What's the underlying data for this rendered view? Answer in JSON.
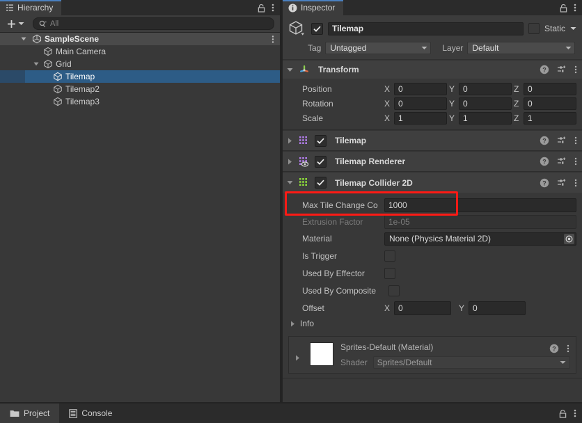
{
  "hierarchy": {
    "tab_label": "Hierarchy",
    "tab_icon": "hierarchy-icon",
    "lock_icon": "lock-icon",
    "menu_icon": "kebab-menu-icon",
    "create_button_label": "+",
    "search": {
      "placeholder": "All",
      "value": "",
      "icon": "search-icon"
    },
    "items": [
      {
        "label": "SampleScene",
        "depth": 0,
        "icon": "unity-scene-icon",
        "expanded": true,
        "selected": false,
        "is_scene": true,
        "has_menu": true
      },
      {
        "label": "Main Camera",
        "depth": 2,
        "icon": "gameobject-cube-icon",
        "expanded": null,
        "selected": false,
        "is_scene": false,
        "has_menu": false
      },
      {
        "label": "Grid",
        "depth": 1,
        "icon": "gameobject-cube-icon",
        "expanded": true,
        "selected": false,
        "is_scene": false,
        "has_menu": false
      },
      {
        "label": "Tilemap",
        "depth": 2,
        "icon": "gameobject-cube-icon",
        "expanded": null,
        "selected": true,
        "is_scene": false,
        "has_menu": false
      },
      {
        "label": "Tilemap2",
        "depth": 2,
        "icon": "gameobject-cube-icon",
        "expanded": null,
        "selected": false,
        "is_scene": false,
        "has_menu": false
      },
      {
        "label": "Tilemap3",
        "depth": 2,
        "icon": "gameobject-cube-icon",
        "expanded": null,
        "selected": false,
        "is_scene": false,
        "has_menu": false
      }
    ]
  },
  "inspector": {
    "tab_label": "Inspector",
    "tab_icon": "info-icon",
    "lock_icon": "lock-icon",
    "menu_icon": "kebab-menu-icon",
    "gameobject": {
      "icon": "gameobject-cube-icon",
      "enabled": true,
      "name": "Tilemap",
      "static_label": "Static",
      "static_checked": false,
      "tag_label": "Tag",
      "tag_value": "Untagged",
      "layer_label": "Layer",
      "layer_value": "Default"
    },
    "components": [
      {
        "name": "Transform",
        "icon": "transform-axis-icon",
        "expanded": true,
        "has_enable_checkbox": false,
        "enabled": true,
        "highlighted": false,
        "rows": [
          {
            "kind": "vector3",
            "label": "Position",
            "x": "0",
            "y": "0",
            "z": "0"
          },
          {
            "kind": "vector3",
            "label": "Rotation",
            "x": "0",
            "y": "0",
            "z": "0"
          },
          {
            "kind": "vector3",
            "label": "Scale",
            "x": "1",
            "y": "1",
            "z": "1"
          }
        ]
      },
      {
        "name": "Tilemap",
        "icon": "tilemap-purple-icon",
        "expanded": false,
        "has_enable_checkbox": true,
        "enabled": true,
        "highlighted": false,
        "rows": []
      },
      {
        "name": "Tilemap Renderer",
        "icon": "tilemap-renderer-purple-icon",
        "expanded": false,
        "has_enable_checkbox": true,
        "enabled": true,
        "highlighted": false,
        "rows": []
      },
      {
        "name": "Tilemap Collider 2D",
        "icon": "tilemap-collider-green-icon",
        "expanded": true,
        "has_enable_checkbox": true,
        "enabled": true,
        "highlighted": true,
        "rows": [
          {
            "kind": "text",
            "label": "Max Tile Change Co",
            "value": "1000",
            "disabled": false
          },
          {
            "kind": "text",
            "label": "Extrusion Factor",
            "value": "1e-05",
            "disabled": true
          },
          {
            "kind": "object",
            "label": "Material",
            "value": "None (Physics Material 2D)",
            "picker_icon": "object-picker-icon"
          },
          {
            "kind": "checkbox",
            "label": "Is Trigger",
            "checked": false
          },
          {
            "kind": "checkbox",
            "label": "Used By Effector",
            "checked": false
          },
          {
            "kind": "checkbox",
            "label": "Used By Composite",
            "checked": false
          },
          {
            "kind": "vector2",
            "label": "Offset",
            "x": "0",
            "y": "0"
          },
          {
            "kind": "foldout",
            "label": "Info",
            "expanded": false
          }
        ]
      }
    ],
    "header_icons": {
      "help": "help-icon",
      "preset": "preset-icon",
      "menu": "kebab-menu-icon"
    },
    "material_preview": {
      "title": "Sprites-Default (Material)",
      "shader_label": "Shader",
      "shader_value": "Sprites/Default",
      "swatch_color": "#ffffff",
      "help_icon": "help-icon",
      "menu_icon": "kebab-menu-icon",
      "expanded": false
    }
  },
  "bottom_bar": {
    "tabs": [
      {
        "label": "Project",
        "icon": "folder-icon",
        "active": true
      },
      {
        "label": "Console",
        "icon": "console-icon",
        "active": false
      }
    ],
    "lock_icon": "lock-icon",
    "menu_icon": "kebab-menu-icon"
  },
  "annotation": {
    "highlight_color": "#ff1a15",
    "target": "Tilemap Collider 2D"
  },
  "colors": {
    "panel_bg": "#383838",
    "header_bg": "#3c3c3c",
    "selection_blue": "#2d5c86",
    "tab_accent": "#4a80c0",
    "field_bg": "#2a2a2a"
  }
}
